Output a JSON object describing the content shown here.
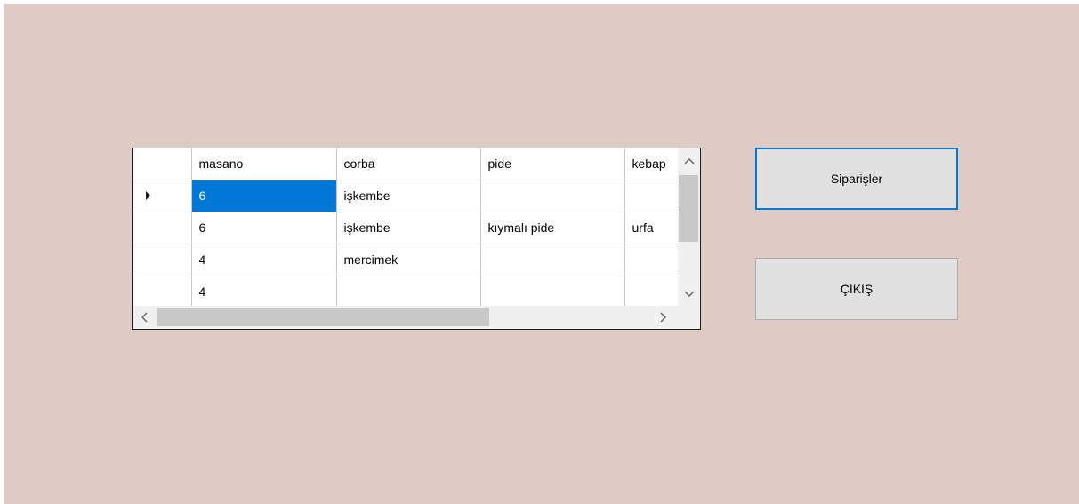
{
  "grid": {
    "columns": [
      "masano",
      "corba",
      "pide",
      "kebap"
    ],
    "rows": [
      {
        "current": true,
        "cells": [
          "6",
          "işkembe",
          "",
          ""
        ]
      },
      {
        "current": false,
        "cells": [
          "6",
          "işkembe",
          "kıymalı pide",
          "urfa"
        ]
      },
      {
        "current": false,
        "cells": [
          "4",
          "mercimek",
          "",
          ""
        ]
      },
      {
        "current": false,
        "cells": [
          "4",
          "",
          "",
          ""
        ]
      }
    ],
    "selected_cell": {
      "row": 0,
      "col": 0
    },
    "scroll": {
      "up_icon": "^",
      "down_icon": "v",
      "left_icon": "<",
      "right_icon": ">"
    }
  },
  "buttons": {
    "siparisler_label": "Siparişler",
    "cikis_label": "ÇIKIŞ"
  },
  "colors": {
    "form_background": "#decbc5",
    "selection": "#0078d7",
    "button_focus_border": "#0078d7"
  }
}
